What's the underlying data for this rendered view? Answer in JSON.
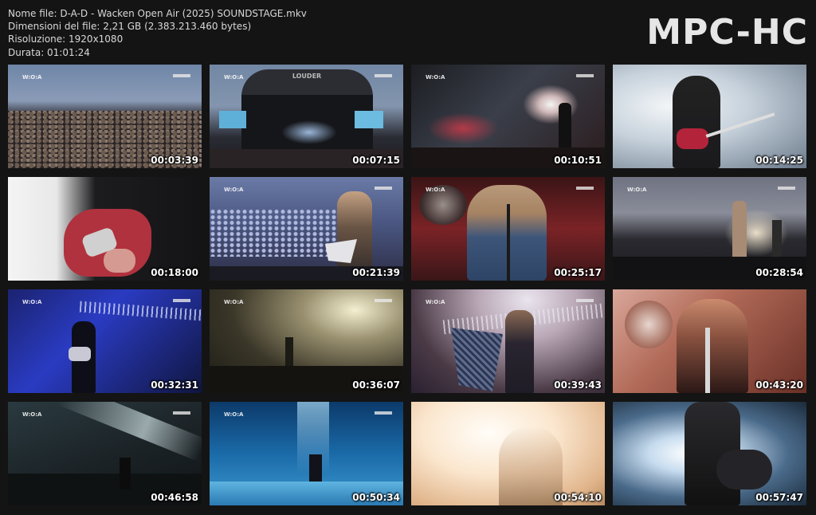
{
  "file_info": {
    "name_line": "Nome file: D-A-D - Wacken Open Air (2025) SOUNDSTAGE.mkv",
    "size_line": "Dimensioni del file: 2,21 GB (2.383.213.460 bytes)",
    "resolution_line": "Risoluzione: 1920x1080",
    "duration_line": "Durata: 01:01:24"
  },
  "brand": "MPC-HC",
  "stage_sign": "LOUDER",
  "thumbnails": [
    {
      "timestamp": "00:03:39"
    },
    {
      "timestamp": "00:07:15"
    },
    {
      "timestamp": "00:10:51"
    },
    {
      "timestamp": "00:14:25"
    },
    {
      "timestamp": "00:18:00"
    },
    {
      "timestamp": "00:21:39"
    },
    {
      "timestamp": "00:25:17"
    },
    {
      "timestamp": "00:28:54"
    },
    {
      "timestamp": "00:32:31"
    },
    {
      "timestamp": "00:36:07"
    },
    {
      "timestamp": "00:39:43"
    },
    {
      "timestamp": "00:43:20"
    },
    {
      "timestamp": "00:46:58"
    },
    {
      "timestamp": "00:50:34"
    },
    {
      "timestamp": "00:54:10"
    },
    {
      "timestamp": "00:57:47"
    }
  ]
}
